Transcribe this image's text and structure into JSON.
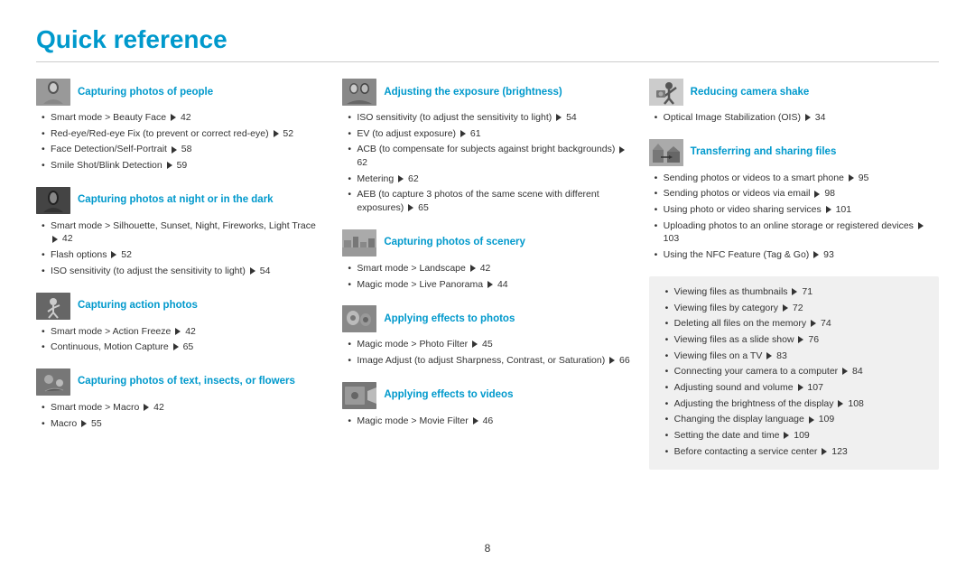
{
  "page": {
    "title": "Quick reference",
    "page_number": "8"
  },
  "columns": [
    {
      "id": "col1",
      "sections": [
        {
          "id": "people",
          "icon": "people",
          "title": "Capturing photos of people",
          "items": [
            "Smart mode > Beauty Face ▶ 42",
            "Red-eye/Red-eye Fix (to prevent or correct red-eye) ▶ 52",
            "Face Detection/Self-Portrait ▶ 58",
            "Smile Shot/Blink Detection ▶ 59"
          ]
        },
        {
          "id": "night",
          "icon": "night",
          "title": "Capturing photos at night or in the dark",
          "items": [
            "Smart mode > Silhouette, Sunset, Night, Fireworks, Light Trace ▶ 42",
            "Flash options ▶ 52",
            "ISO sensitivity (to adjust the sensitivity to light) ▶ 54"
          ]
        },
        {
          "id": "action",
          "icon": "action",
          "title": "Capturing action photos",
          "items": [
            "Smart mode > Action Freeze ▶ 42",
            "Continuous, Motion Capture ▶ 65"
          ]
        },
        {
          "id": "macro",
          "icon": "macro",
          "title": "Capturing photos of text, insects, or flowers",
          "items": [
            "Smart mode > Macro ▶ 42",
            "Macro ▶ 55"
          ]
        }
      ]
    },
    {
      "id": "col2",
      "sections": [
        {
          "id": "exposure",
          "icon": "exposure",
          "title": "Adjusting the exposure (brightness)",
          "items": [
            "ISO sensitivity (to adjust the sensitivity to light) ▶ 54",
            "EV (to adjust exposure) ▶ 61",
            "ACB (to compensate for subjects against bright backgrounds) ▶ 62",
            "Metering ▶ 62",
            "AEB (to capture 3 photos of the same scene with different exposures) ▶ 65"
          ]
        },
        {
          "id": "scenery",
          "icon": "scenery",
          "title": "Capturing photos of scenery",
          "items": [
            "Smart mode > Landscape ▶ 42",
            "Magic mode > Live Panorama ▶ 44"
          ]
        },
        {
          "id": "effects",
          "icon": "effects",
          "title": "Applying effects to photos",
          "items": [
            "Magic mode > Photo Filter ▶ 45",
            "Image Adjust (to adjust Sharpness, Contrast, or Saturation) ▶ 66"
          ]
        },
        {
          "id": "video-effects",
          "icon": "video",
          "title": "Applying effects to videos",
          "items": [
            "Magic mode > Movie Filter ▶ 46"
          ]
        }
      ]
    },
    {
      "id": "col3",
      "sections": [
        {
          "id": "shake",
          "icon": "shake",
          "title": "Reducing camera shake",
          "items": [
            "Optical Image Stabilization (OIS) ▶ 34"
          ]
        },
        {
          "id": "transfer",
          "icon": "transfer",
          "title": "Transferring and sharing files",
          "items": [
            "Sending photos or videos to a smart phone ▶ 95",
            "Sending photos or videos via email ▶ 98",
            "Using photo or video sharing services ▶ 101",
            "Uploading photos to an online storage or registered devices ▶ 103",
            "Using the NFC Feature (Tag & Go) ▶ 93"
          ]
        }
      ],
      "gray_box": {
        "items": [
          "Viewing files as thumbnails ▶ 71",
          "Viewing files by category ▶ 72",
          "Deleting all files on the memory ▶ 74",
          "Viewing files as a slide show ▶ 76",
          "Viewing files on a TV ▶ 83",
          "Connecting your camera to a computer ▶ 84",
          "Adjusting sound and volume ▶ 107",
          "Adjusting the brightness of the display ▶ 108",
          "Changing the display language ▶ 109",
          "Setting the date and time ▶ 109",
          "Before contacting a service center ▶ 123"
        ]
      }
    }
  ]
}
